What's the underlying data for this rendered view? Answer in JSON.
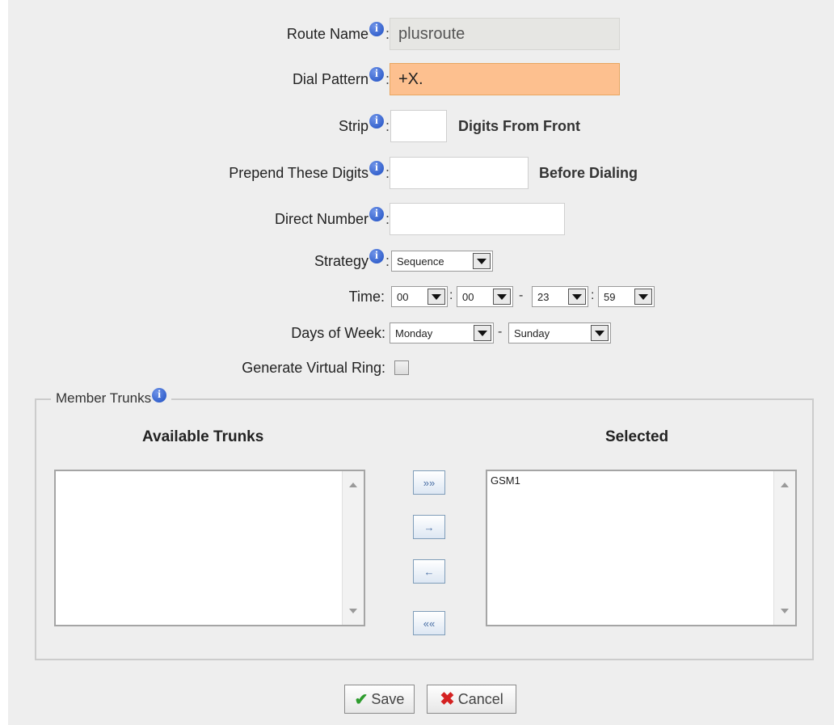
{
  "form": {
    "route_name": {
      "label": "Route Name",
      "value": "plusroute"
    },
    "dial_pattern": {
      "label": "Dial Pattern",
      "value": "+X."
    },
    "strip": {
      "label": "Strip",
      "value": "",
      "suffix": "Digits From Front"
    },
    "prepend": {
      "label": "Prepend These Digits",
      "value": "",
      "suffix": "Before Dialing"
    },
    "direct_number": {
      "label": "Direct Number",
      "value": ""
    },
    "strategy": {
      "label": "Strategy",
      "selected": "Sequence"
    },
    "time": {
      "label": "Time:",
      "start_hour": "00",
      "start_minute": "00",
      "range_sep": "-",
      "end_hour": "23",
      "end_minute": "59",
      "colon": ":"
    },
    "days_of_week": {
      "label": "Days of Week:",
      "start_day": "Monday",
      "range_sep": "-",
      "end_day": "Sunday"
    },
    "virtual_ring": {
      "label": "Generate Virtual Ring:",
      "checked": false
    },
    "colon": ":"
  },
  "member_trunks": {
    "legend": "Member Trunks",
    "available_header": "Available Trunks",
    "selected_header": "Selected",
    "available": [],
    "selected": [
      "GSM1"
    ],
    "buttons": {
      "add_all": "»»",
      "add": "→",
      "remove": "←",
      "remove_all": "««"
    }
  },
  "actions": {
    "save": "Save",
    "cancel": "Cancel"
  },
  "icons": {
    "info": "info-icon",
    "save": "check-icon",
    "cancel": "x-icon"
  },
  "colors": {
    "focused_field": "#fdc08f",
    "readonly_field": "#e6e6e3",
    "info_icon": "#2a5bd0"
  }
}
